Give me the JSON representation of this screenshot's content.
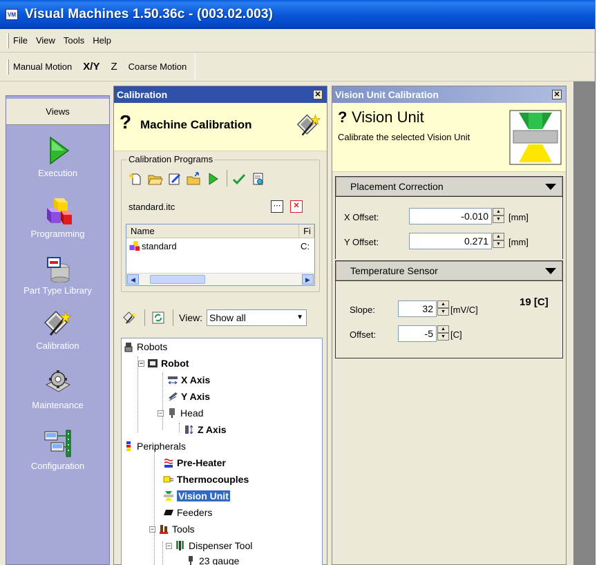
{
  "window": {
    "app_icon_text": "VM",
    "title": "Visual Machines 1.50.36c - (003.02.003)"
  },
  "menu": [
    "File",
    "View",
    "Tools",
    "Help"
  ],
  "toolbar": {
    "manual_motion": "Manual Motion",
    "xy": "X/Y",
    "z": "Z",
    "coarse_motion": "Coarse Motion"
  },
  "views": {
    "header": "Views",
    "items": [
      {
        "label": "Execution",
        "icon": "play-icon"
      },
      {
        "label": "Programming",
        "icon": "cubes-icon"
      },
      {
        "label": "Part Type Library",
        "icon": "part-library-icon"
      },
      {
        "label": "Calibration",
        "icon": "calibration-wand-icon"
      },
      {
        "label": "Maintenance",
        "icon": "gear-icon"
      },
      {
        "label": "Configuration",
        "icon": "network-icon"
      }
    ]
  },
  "calibration": {
    "panel_title": "Calibration",
    "header_q": "?",
    "header_title": "Machine Calibration",
    "group_label": "Calibration Programs",
    "current_file": "standard.itc",
    "list_columns": [
      "Name",
      "Fi"
    ],
    "list_rows": [
      {
        "name": "standard",
        "file": "C:"
      }
    ],
    "view_label": "View:",
    "view_selected": "Show all",
    "tree": [
      {
        "label": "Robots",
        "bold": false
      },
      {
        "label": "Robot",
        "bold": true
      },
      {
        "label": "X Axis",
        "bold": true
      },
      {
        "label": "Y Axis",
        "bold": true
      },
      {
        "label": "Head",
        "bold": false
      },
      {
        "label": "Z Axis",
        "bold": true
      },
      {
        "label": "Peripherals",
        "bold": false
      },
      {
        "label": "Pre-Heater",
        "bold": true
      },
      {
        "label": "Thermocouples",
        "bold": true
      },
      {
        "label": "Vision Unit",
        "bold": true
      },
      {
        "label": "Feeders",
        "bold": false
      },
      {
        "label": "Tools",
        "bold": false
      },
      {
        "label": "Dispenser Tool",
        "bold": false
      },
      {
        "label": "23 gauge",
        "bold": false
      }
    ]
  },
  "vision": {
    "panel_title": "Vision Unit Calibration",
    "header_q": "?",
    "header_title": "Vision Unit",
    "header_desc": "Calibrate the selected Vision Unit",
    "placement": {
      "section": "Placement Correction",
      "x_label": "X Offset:",
      "x_value": "-0.010",
      "y_label": "Y Offset:",
      "y_value": "0.271",
      "unit": "[mm]"
    },
    "temperature": {
      "section": "Temperature Sensor",
      "slope_label": "Slope:",
      "slope_value": "32",
      "slope_unit": "[mV/C]",
      "offset_label": "Offset:",
      "offset_value": "-5",
      "offset_unit": "[C]",
      "reading": "19 [C]"
    }
  }
}
